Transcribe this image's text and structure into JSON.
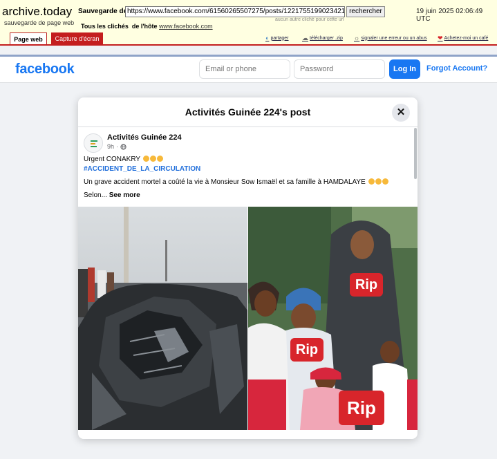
{
  "archive": {
    "logo": "archive.today",
    "subtitle": "sauvegarde de page web",
    "save_label": "Sauvegarde de",
    "url": "https://www.facebook.com/61560265507275/posts/122175519902342183",
    "search_button": "rechercher",
    "hint": "aucun autre cliché pour cette url",
    "date": "19 juin 2025 02:06:49 UTC",
    "all_snapshots_label": "Tous les clichés",
    "host_label": "de l'hôte",
    "host_link": "www.facebook.com",
    "tab_web": "Page web",
    "tab_capture": "Capture d'écran",
    "actions": [
      {
        "icon": "share-icon",
        "label": "partager"
      },
      {
        "icon": "download-icon",
        "label": "télécharger .zip"
      },
      {
        "icon": "report-icon",
        "label": "signaler une erreur ou un abus"
      },
      {
        "icon": "heart-icon",
        "label": "Achetez-moi un café"
      }
    ]
  },
  "facebook": {
    "logo": "facebook",
    "email_placeholder": "Email or phone",
    "password_placeholder": "Password",
    "login_label": "Log In",
    "forgot_label": "Forgot Account?",
    "brand_color": "#1877f2"
  },
  "post": {
    "modal_title": "Activités Guinée 224's post",
    "close_icon": "close-icon",
    "page_name": "Activités Guinée 224",
    "time": "9h",
    "privacy_icon": "globe-icon",
    "line1": "Urgent CONAKRY",
    "hashtag": "#ACCIDENT_DE_LA_CIRCULATION",
    "line2": "Un grave accident mortel a coûté la vie à Monsieur Sow Ismaël et sa famille à HAMDALAYE",
    "truncated": "Selon...",
    "see_more": "See more",
    "photo_left": "wrecked-car-photo",
    "photo_right": "family-photo",
    "rip_labels": [
      "Rip",
      "Rip",
      "Rip"
    ]
  }
}
